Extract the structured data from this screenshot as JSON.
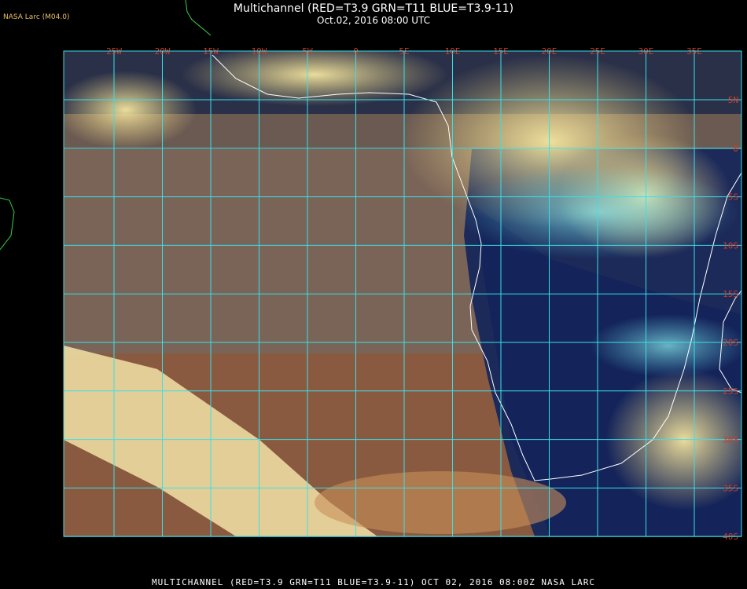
{
  "header": {
    "title": "Multichannel (RED=T3.9 GRN=T11 BLUE=T3.9-11)",
    "subtitle": "Oct.02, 2016 08:00 UTC",
    "source": "NASA Larc (M04.0)"
  },
  "footer": {
    "caption": "MULTICHANNEL (RED=T3.9 GRN=T11 BLUE=T3.9-11) OCT 02, 2016 08:00Z  NASA LARC"
  },
  "map": {
    "lon_labels": [
      "25W",
      "20W",
      "15W",
      "10W",
      "5W",
      "0",
      "5E",
      "10E",
      "15E",
      "20E",
      "25E",
      "30E",
      "35E"
    ],
    "lat_labels": [
      "5N",
      "0",
      "5S",
      "10S",
      "15S",
      "20S",
      "25S",
      "30S",
      "35S",
      "40S"
    ],
    "colors": {
      "grid": "#38e0e8",
      "coast": "#ffffff",
      "tick": "#d23a2a"
    }
  }
}
